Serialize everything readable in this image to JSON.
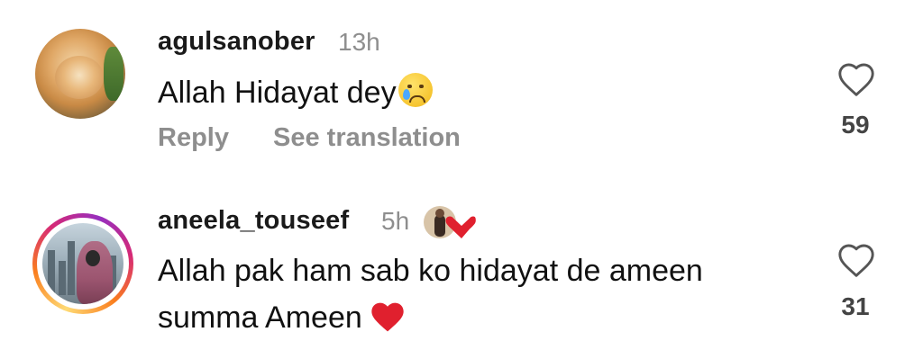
{
  "comments": [
    {
      "username": "agulsanober",
      "time": "13h",
      "text": "Allah Hidayat dey",
      "text_emoji": "crying-face",
      "reply_label": "Reply",
      "translate_label": "See translation",
      "like_count": "59"
    },
    {
      "username": "aneela_touseef",
      "time": "5h",
      "text_line1": "Allah pak ham sab ko hidayat de ameen",
      "text_line2": "summa Ameen",
      "text_emoji": "red-heart",
      "like_count": "31"
    }
  ],
  "colors": {
    "secondary_text": "#8e8e8e",
    "heart_emoji": "#e0202e",
    "story_ring": [
      "#feda75",
      "#fa7e1e",
      "#d62976",
      "#962fbf"
    ]
  }
}
